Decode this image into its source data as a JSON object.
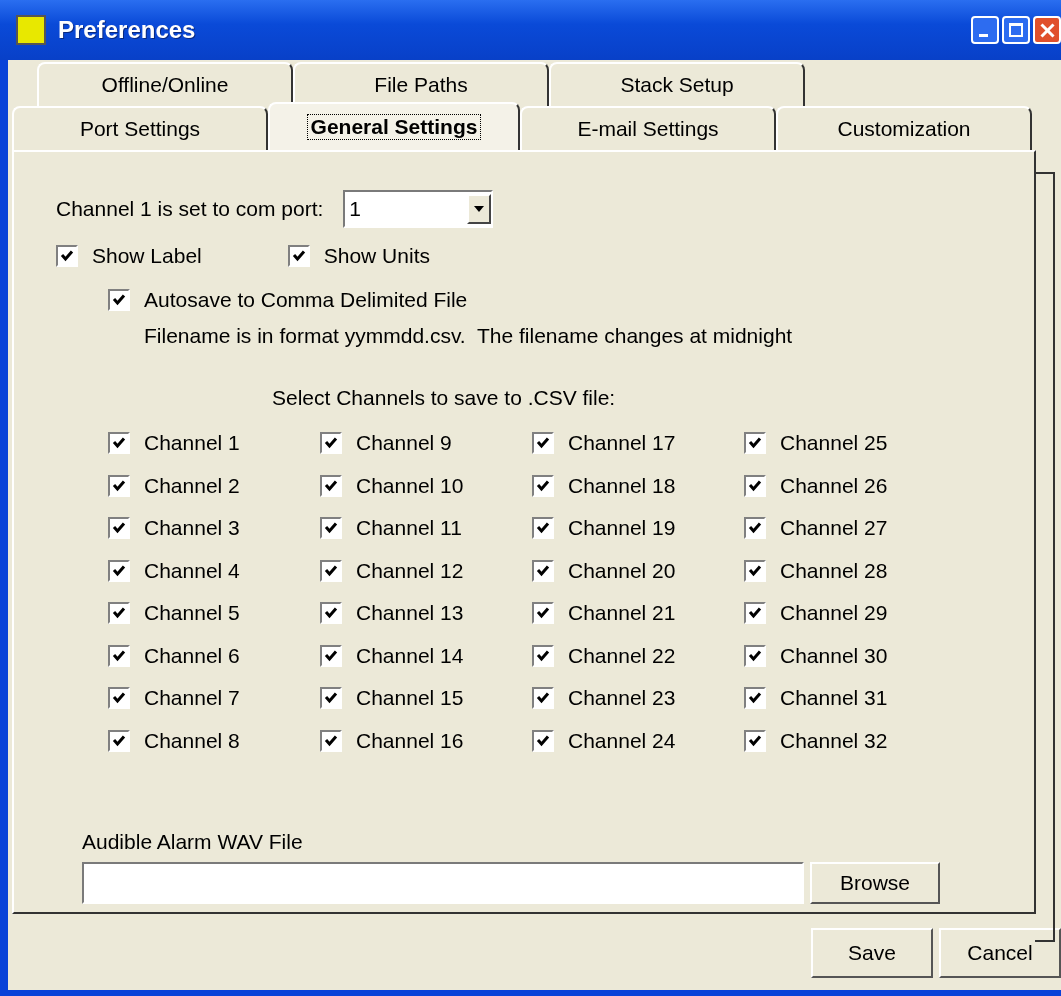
{
  "window": {
    "title": "Preferences"
  },
  "tab_rows": [
    [
      {
        "label": "Offline/Online",
        "selected": false
      },
      {
        "label": "File Paths",
        "selected": false
      },
      {
        "label": "Stack Setup",
        "selected": false
      }
    ],
    [
      {
        "label": "Port Settings",
        "selected": false
      },
      {
        "label": "General Settings",
        "selected": true
      },
      {
        "label": "E-mail Settings",
        "selected": false
      },
      {
        "label": "Customization",
        "selected": false
      }
    ]
  ],
  "com_port": {
    "label": "Channel 1 is set to com port:",
    "value": "1"
  },
  "options": [
    {
      "label": "Show Label",
      "checked": true
    },
    {
      "label": "Show Units",
      "checked": true
    }
  ],
  "autosave": {
    "label": "Autosave to Comma Delimited File",
    "checked": true,
    "note": "Filename is in format yymmdd.csv.  The filename changes at midnight"
  },
  "channels": {
    "heading": "Select Channels to save to .CSV file:",
    "items": [
      {
        "label": "Channel 1",
        "checked": true
      },
      {
        "label": "Channel 2",
        "checked": true
      },
      {
        "label": "Channel 3",
        "checked": true
      },
      {
        "label": "Channel 4",
        "checked": true
      },
      {
        "label": "Channel 5",
        "checked": true
      },
      {
        "label": "Channel 6",
        "checked": true
      },
      {
        "label": "Channel 7",
        "checked": true
      },
      {
        "label": "Channel 8",
        "checked": true
      },
      {
        "label": "Channel 9",
        "checked": true
      },
      {
        "label": "Channel 10",
        "checked": true
      },
      {
        "label": "Channel 11",
        "checked": true
      },
      {
        "label": "Channel 12",
        "checked": true
      },
      {
        "label": "Channel 13",
        "checked": true
      },
      {
        "label": "Channel 14",
        "checked": true
      },
      {
        "label": "Channel 15",
        "checked": true
      },
      {
        "label": "Channel 16",
        "checked": true
      },
      {
        "label": "Channel 17",
        "checked": true
      },
      {
        "label": "Channel 18",
        "checked": true
      },
      {
        "label": "Channel 19",
        "checked": true
      },
      {
        "label": "Channel 20",
        "checked": true
      },
      {
        "label": "Channel 21",
        "checked": true
      },
      {
        "label": "Channel 22",
        "checked": true
      },
      {
        "label": "Channel 23",
        "checked": true
      },
      {
        "label": "Channel 24",
        "checked": true
      },
      {
        "label": "Channel 25",
        "checked": true
      },
      {
        "label": "Channel 26",
        "checked": true
      },
      {
        "label": "Channel 27",
        "checked": true
      },
      {
        "label": "Channel 28",
        "checked": true
      },
      {
        "label": "Channel 29",
        "checked": true
      },
      {
        "label": "Channel 30",
        "checked": true
      },
      {
        "label": "Channel 31",
        "checked": true
      },
      {
        "label": "Channel 32",
        "checked": true
      }
    ]
  },
  "alarm": {
    "label": "Audible Alarm WAV File",
    "browse": "Browse"
  },
  "buttons": [
    "Save",
    "Cancel"
  ]
}
